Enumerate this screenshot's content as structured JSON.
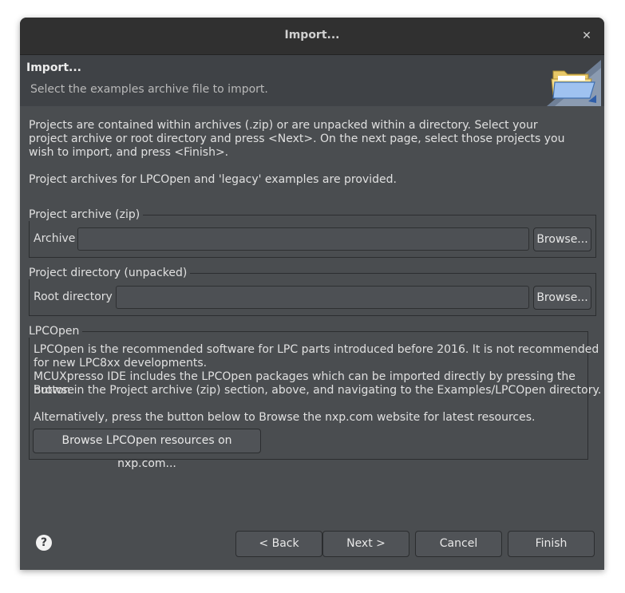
{
  "window": {
    "title": "Import...",
    "close_glyph": "✕"
  },
  "header": {
    "title": "Import...",
    "subtitle": "Select the examples archive file to import.",
    "icon": "folder-icon"
  },
  "intro": {
    "line1": "Projects are contained within archives (.zip) or are unpacked within a directory. Select your",
    "line2": "project archive or root directory and press <Next>. On the next page, select those projects you",
    "line3": "wish to import, and press <Finish>.",
    "line4": "Project archives for LPCOpen and 'legacy' examples are provided."
  },
  "archive_group": {
    "label": "Project archive (zip)",
    "field_label": "Archive",
    "value": "",
    "browse_label": "Browse..."
  },
  "directory_group": {
    "label": "Project directory (unpacked)",
    "field_label": "Root directory",
    "value": "",
    "browse_label": "Browse..."
  },
  "lpcopen_group": {
    "label": "LPCOpen",
    "line1": "LPCOpen is the recommended software for LPC parts introduced before 2016. It is not recommended",
    "line2": "for new LPC8xx developments.",
    "line3": "MCUXpresso IDE includes the LPCOpen packages which can be imported directly by pressing the Browse",
    "line4": "button in the Project archive (zip) section, above, and navigating to the Examples/LPCOpen directory.",
    "line5": "Alternatively, press the button below to Browse the nxp.com website for latest resources.",
    "button_label": "Browse LPCOpen resources on nxp.com..."
  },
  "footer": {
    "help_glyph": "?",
    "back_label": "< Back",
    "next_label": "Next >",
    "cancel_label": "Cancel",
    "finish_label": "Finish"
  },
  "colors": {
    "window_bg": "#4a4d50",
    "titlebar_bg": "#303030",
    "header_bg": "#3f4246"
  }
}
